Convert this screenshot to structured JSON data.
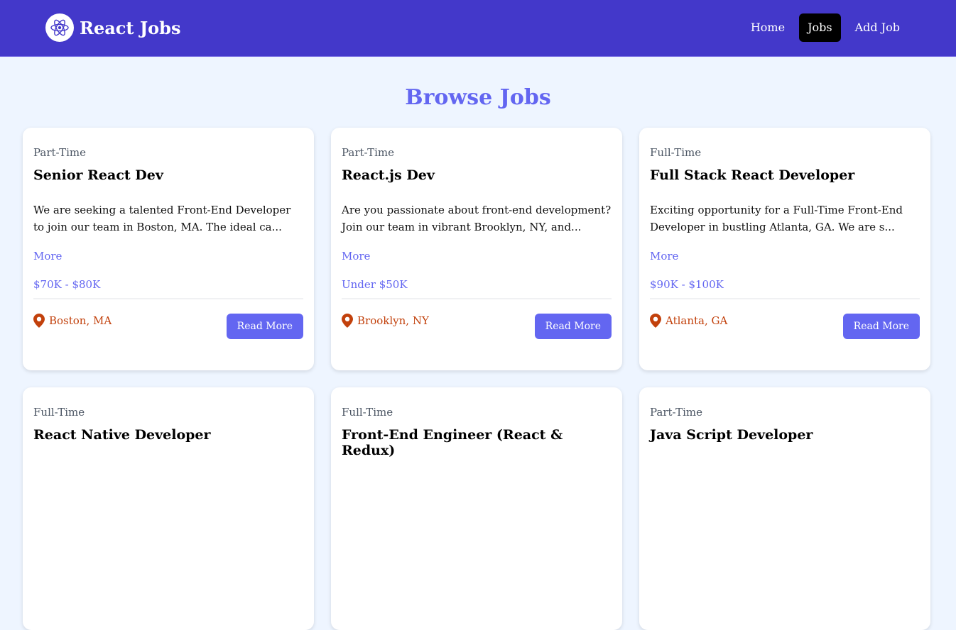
{
  "brand": {
    "name": "React Jobs",
    "logo_icon": "react-atom-icon"
  },
  "nav": [
    {
      "label": "Home",
      "active": false
    },
    {
      "label": "Jobs",
      "active": true
    },
    {
      "label": "Add Job",
      "active": false
    }
  ],
  "page_title": "Browse Jobs",
  "jobs": [
    {
      "type": "Part-Time",
      "title": "Senior React Dev",
      "description": "We are seeking a talented Front-End Developer to join our team in Boston, MA. The ideal ca...",
      "more_label": "More",
      "salary": "$70K - $80K",
      "location": "Boston, MA",
      "cta": "Read More"
    },
    {
      "type": "Part-Time",
      "title": "React.js Dev",
      "description": "Are you passionate about front-end development? Join our team in vibrant Brooklyn, NY, and...",
      "more_label": "More",
      "salary": "Under $50K",
      "location": "Brooklyn, NY",
      "cta": "Read More"
    },
    {
      "type": "Full-Time",
      "title": "Full Stack React Developer",
      "description": "Exciting opportunity for a Full-Time Front-End Developer in bustling Atlanta, GA. We are s...",
      "more_label": "More",
      "salary": "$90K - $100K",
      "location": "Atlanta, GA",
      "cta": "Read More"
    },
    {
      "type": "Full-Time",
      "title": "React Native Developer"
    },
    {
      "type": "Full-Time",
      "title": "Front-End Engineer (React & Redux)"
    },
    {
      "type": "Part-Time",
      "title": "Java Script Developer"
    }
  ],
  "colors": {
    "navbar": "#4338ca",
    "accent": "#6366f1",
    "location": "#c2410c",
    "background": "#eef5ff"
  }
}
